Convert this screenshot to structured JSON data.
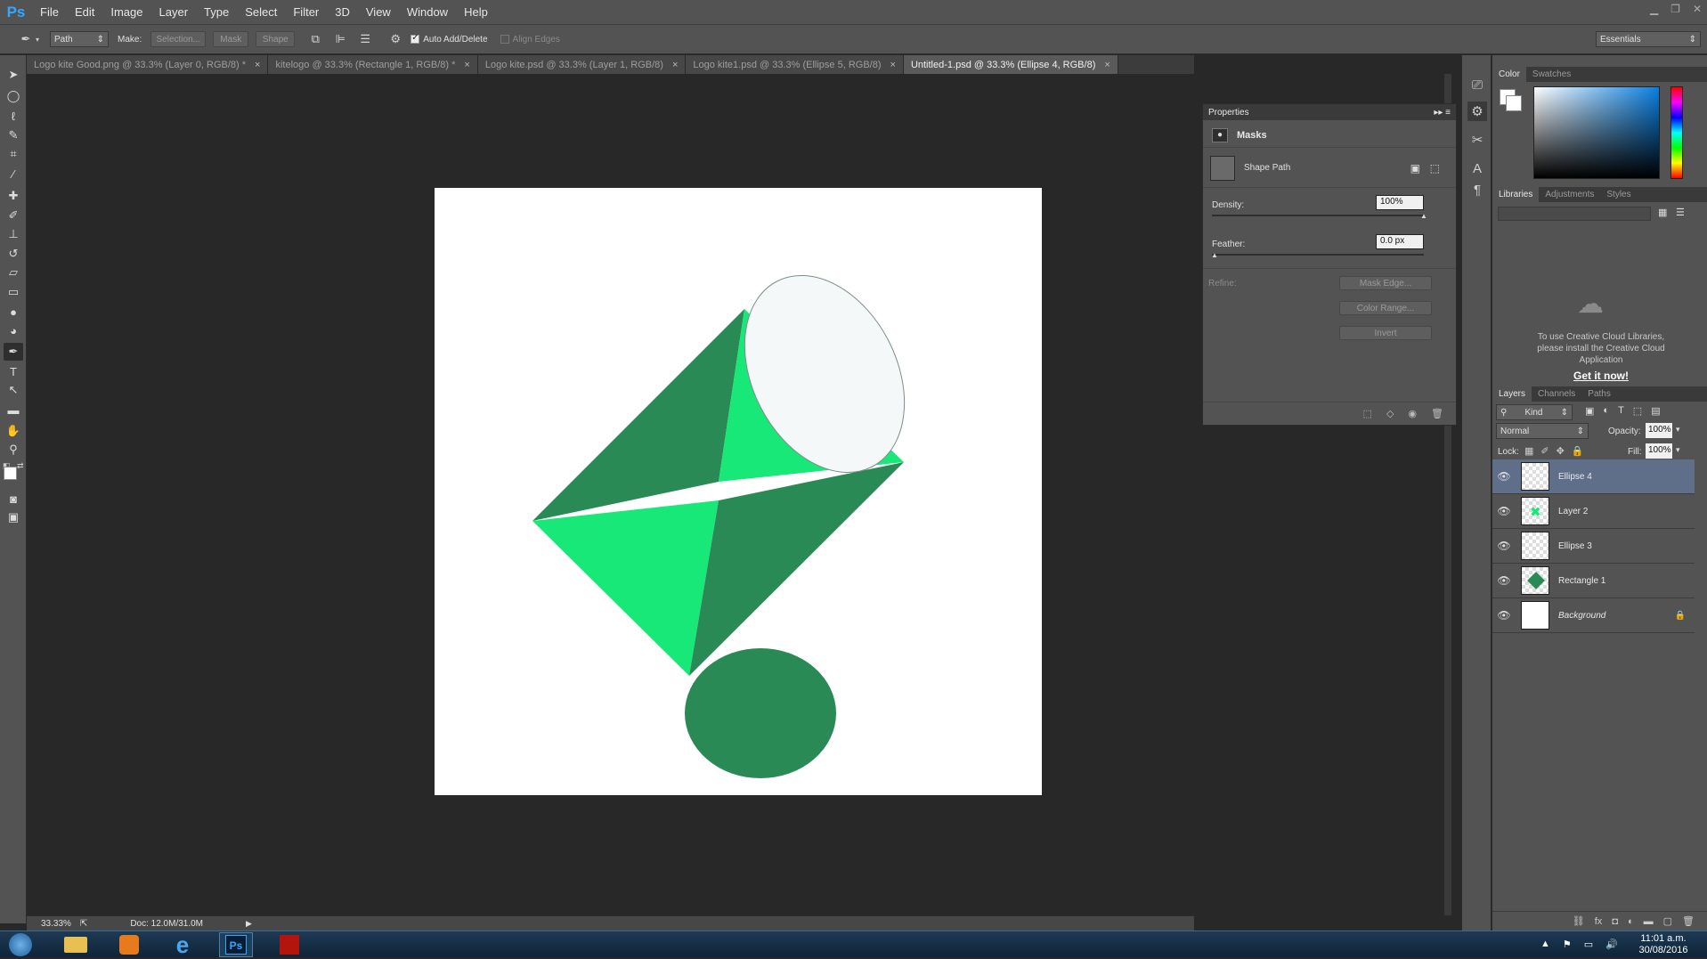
{
  "app": {
    "logo": "Ps"
  },
  "menu": [
    "File",
    "Edit",
    "Image",
    "Layer",
    "Type",
    "Select",
    "Filter",
    "3D",
    "View",
    "Window",
    "Help"
  ],
  "window_controls": [
    "minimize-icon",
    "restore-icon",
    "close-icon"
  ],
  "options": {
    "tool_mode": "Path",
    "make_label": "Make:",
    "selection_btn": "Selection...",
    "mask_btn": "Mask",
    "shape_btn": "Shape",
    "auto_add_delete": "Auto Add/Delete",
    "align_edges": "Align Edges",
    "workspace": "Essentials"
  },
  "tabs": [
    {
      "label": "Logo kite Good.png @ 33.3% (Layer 0, RGB/8) *"
    },
    {
      "label": "kitelogo @ 33.3% (Rectangle 1, RGB/8) *"
    },
    {
      "label": "Logo kite.psd @ 33.3% (Layer 1, RGB/8)"
    },
    {
      "label": "Logo kite1.psd @ 33.3% (Ellipse 5, RGB/8)"
    },
    {
      "label": "Untitled-1.psd @ 33.3% (Ellipse 4, RGB/8)"
    }
  ],
  "tab_close": "×",
  "status": {
    "zoom": "33.33%",
    "doc": "Doc: 12.0M/31.0M"
  },
  "properties": {
    "title": "Properties",
    "section": "Masks",
    "shape_path": "Shape Path",
    "density_label": "Density:",
    "density_value": "100%",
    "density": 1.0,
    "feather_label": "Feather:",
    "feather_value": "0.0 px",
    "feather": 0.0,
    "refine_label": "Refine:",
    "mask_edge": "Mask Edge...",
    "color_range": "Color Range...",
    "invert": "Invert"
  },
  "color_panel": {
    "tabs": [
      "Color",
      "Swatches"
    ]
  },
  "libraries": {
    "tabs": [
      "Libraries",
      "Adjustments",
      "Styles"
    ],
    "message": "To use Creative Cloud Libraries, please install the Creative Cloud Application",
    "link": "Get it now!"
  },
  "layers_panel": {
    "tabs": [
      "Layers",
      "Channels",
      "Paths"
    ],
    "kind": "Kind",
    "blend_mode": "Normal",
    "opacity_label": "Opacity:",
    "opacity_value": "100%",
    "lock_label": "Lock:",
    "fill_label": "Fill:",
    "fill_value": "100%",
    "layers": [
      {
        "name": "Ellipse 4",
        "selected": true
      },
      {
        "name": "Layer 2",
        "selected": false
      },
      {
        "name": "Ellipse 3",
        "selected": false
      },
      {
        "name": "Rectangle 1",
        "selected": false
      },
      {
        "name": "Background",
        "selected": false
      }
    ]
  },
  "colors": {
    "dark_green": "#2a8a56",
    "bright_green": "#18e878",
    "ellipse_top": "#f5f8f8",
    "selection": "#5f6f8a"
  },
  "taskbar": {
    "time": "11:01 a.m.",
    "date": "30/08/2016"
  }
}
